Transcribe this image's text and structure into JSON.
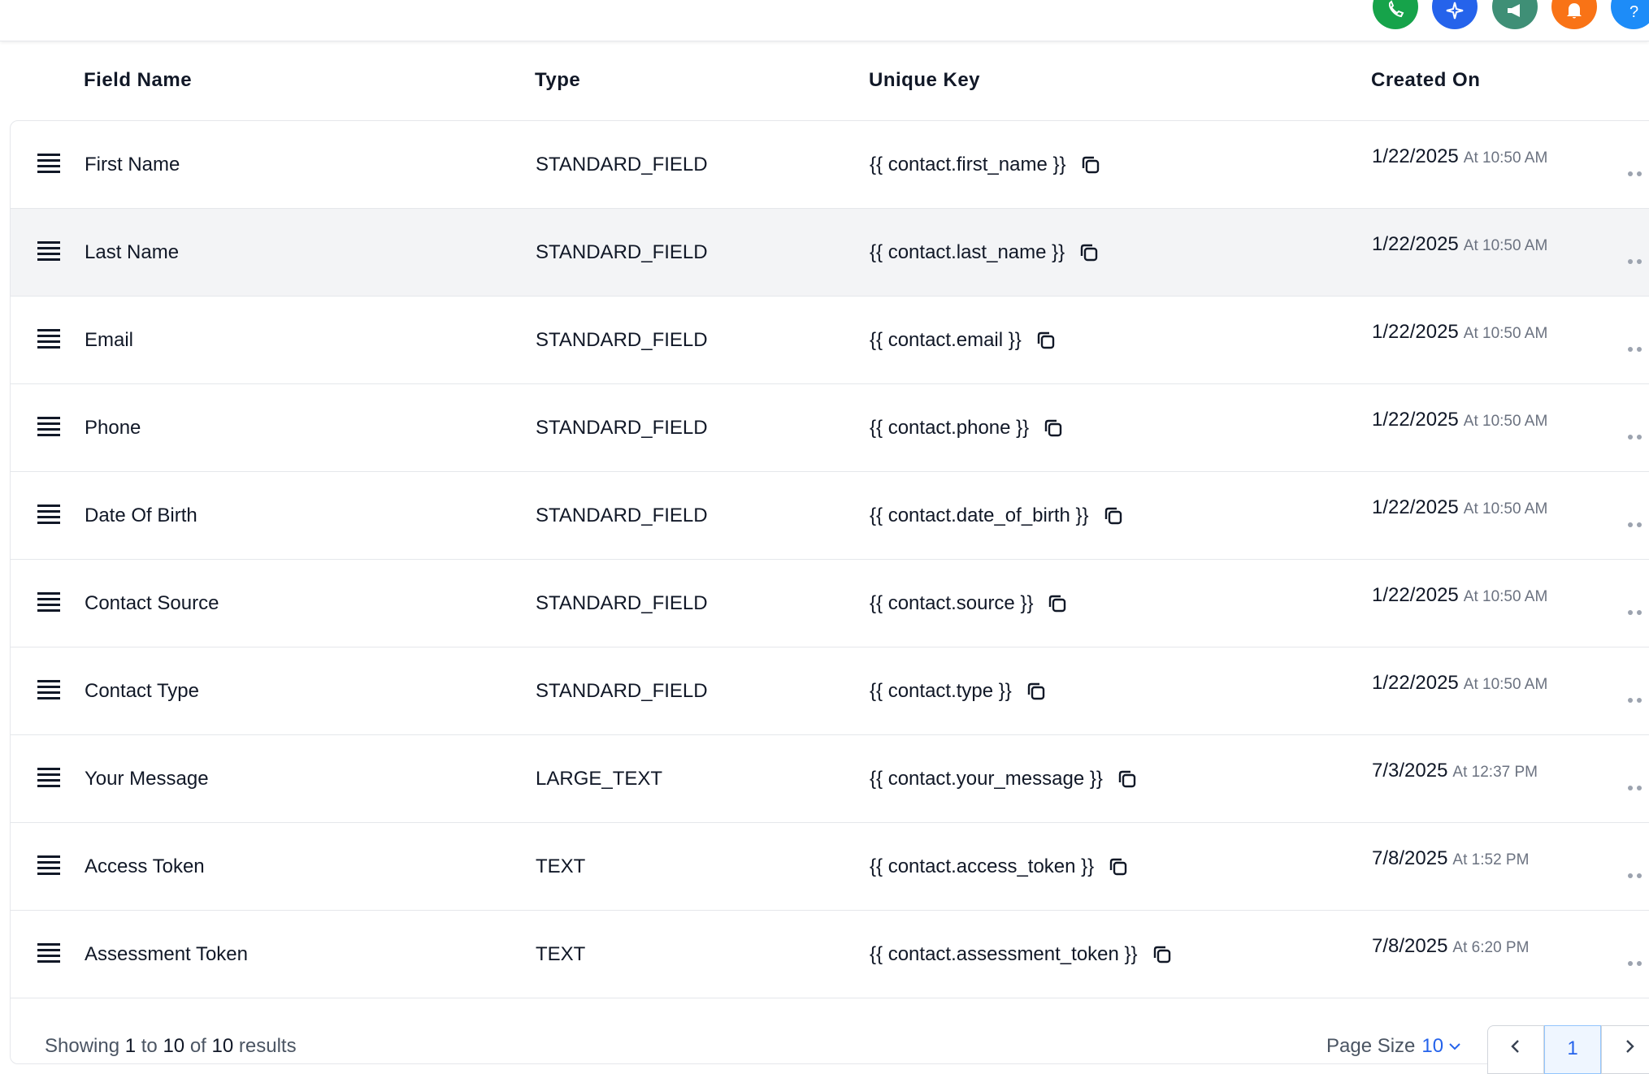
{
  "topbar": {
    "buttons": [
      {
        "name": "phone-icon",
        "color": "#16a34a"
      },
      {
        "name": "sparkle-icon",
        "color": "#2563eb"
      },
      {
        "name": "megaphone-icon",
        "color": "#3f8f76"
      },
      {
        "name": "bell-icon",
        "color": "#f97316"
      },
      {
        "name": "help-icon",
        "color": "#1d8cf8"
      }
    ]
  },
  "table": {
    "columns": [
      "Field Name",
      "Type",
      "Unique Key",
      "Created On"
    ],
    "rows": [
      {
        "field_name": "First Name",
        "type": "STANDARD_FIELD",
        "unique_key": "{{ contact.first_name }}",
        "date": "1/22/2025",
        "time": "At 10:50 AM"
      },
      {
        "field_name": "Last Name",
        "type": "STANDARD_FIELD",
        "unique_key": "{{ contact.last_name }}",
        "date": "1/22/2025",
        "time": "At 10:50 AM"
      },
      {
        "field_name": "Email",
        "type": "STANDARD_FIELD",
        "unique_key": "{{ contact.email }}",
        "date": "1/22/2025",
        "time": "At 10:50 AM"
      },
      {
        "field_name": "Phone",
        "type": "STANDARD_FIELD",
        "unique_key": "{{ contact.phone }}",
        "date": "1/22/2025",
        "time": "At 10:50 AM"
      },
      {
        "field_name": "Date Of Birth",
        "type": "STANDARD_FIELD",
        "unique_key": "{{ contact.date_of_birth }}",
        "date": "1/22/2025",
        "time": "At 10:50 AM"
      },
      {
        "field_name": "Contact Source",
        "type": "STANDARD_FIELD",
        "unique_key": "{{ contact.source }}",
        "date": "1/22/2025",
        "time": "At 10:50 AM"
      },
      {
        "field_name": "Contact Type",
        "type": "STANDARD_FIELD",
        "unique_key": "{{ contact.type }}",
        "date": "1/22/2025",
        "time": "At 10:50 AM"
      },
      {
        "field_name": "Your Message",
        "type": "LARGE_TEXT",
        "unique_key": "{{ contact.your_message }}",
        "date": "7/3/2025",
        "time": "At 12:37 PM"
      },
      {
        "field_name": "Access Token",
        "type": "TEXT",
        "unique_key": "{{ contact.access_token }}",
        "date": "7/8/2025",
        "time": "At 1:52 PM"
      },
      {
        "field_name": "Assessment Token",
        "type": "TEXT",
        "unique_key": "{{ contact.assessment_token }}",
        "date": "7/8/2025",
        "time": "At 6:20 PM"
      }
    ]
  },
  "footer": {
    "showing_prefix": "Showing",
    "from": "1",
    "to_word": "to",
    "to": "10",
    "of_word": "of",
    "total": "10",
    "results_word": "results",
    "page_size_label": "Page Size",
    "page_size_value": "10",
    "current_page": "1"
  }
}
